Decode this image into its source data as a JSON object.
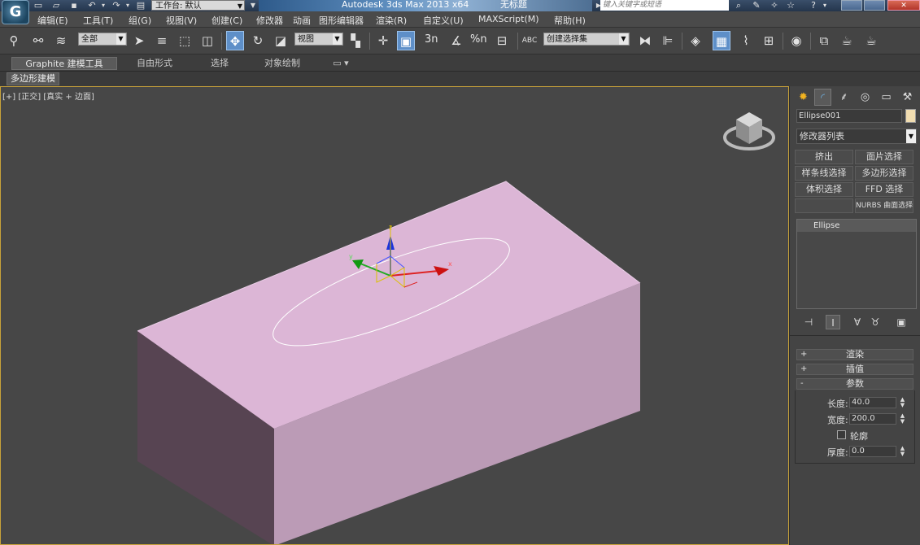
{
  "titlebar": {
    "logo": "G",
    "workspace": "工作台: 默认",
    "app_title": "Autodesk 3ds Max  2013 x64",
    "doc_title": "无标题",
    "search_placeholder": "键入关键字或短语"
  },
  "menu": [
    "编辑(E)",
    "工具(T)",
    "组(G)",
    "视图(V)",
    "创建(C)",
    "修改器",
    "动画",
    "图形编辑器",
    "渲染(R)",
    "自定义(U)",
    "MAXScript(M)",
    "帮助(H)"
  ],
  "toolbar": {
    "selection_filter": "全部",
    "ref_coord": "视图",
    "snap_labels": [
      "3n",
      "%n",
      "n"
    ],
    "named_selection": "创建选择集",
    "abc": "ABC"
  },
  "ribbon": {
    "tabs": [
      "Graphite 建模工具",
      "自由形式",
      "选择",
      "对象绘制"
    ],
    "subtab": "多边形建模"
  },
  "viewport": {
    "label": "[+] [正交] [真实 + 边面]",
    "axis_x": "x",
    "axis_y": "y",
    "axis_z": "z",
    "colors": {
      "box_top": "#dcb6d6",
      "box_front": "#bb9bb6",
      "box_side": "#574452",
      "ellipse": "#ffffff"
    }
  },
  "command_panel": {
    "object_name": "Ellipse001",
    "modifier_list": "修改器列表",
    "buttons": [
      "挤出",
      "面片选择",
      "样条线选择",
      "多边形选择",
      "体积选择",
      "FFD 选择",
      "",
      "NURBS 曲面选择"
    ],
    "stack_item": "Ellipse",
    "rollouts": {
      "render": "渲染",
      "interpolation": "插值",
      "params": "参数"
    },
    "params": {
      "length_label": "长度:",
      "length_value": "40.0",
      "width_label": "宽度:",
      "width_value": "200.0",
      "outline_label": "轮廓",
      "thickness_label": "厚度:",
      "thickness_value": "0.0"
    }
  }
}
